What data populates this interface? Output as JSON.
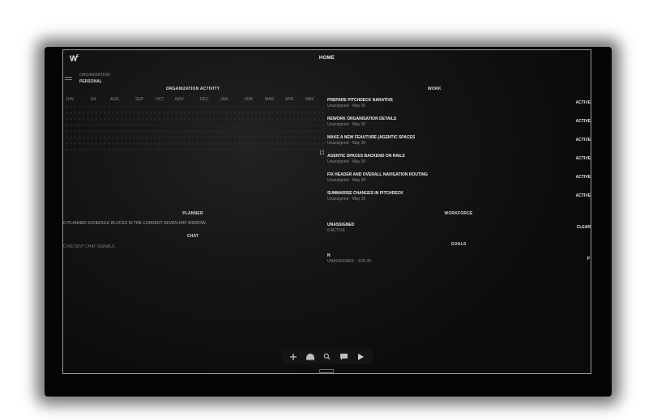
{
  "header": {
    "logo": "W",
    "title": "HOME"
  },
  "org_switcher": {
    "label": "ORGANIZATION",
    "value": "PERSONAL"
  },
  "activity": {
    "title": "ORGANIZATION ACTIVITY",
    "months": [
      "JUN",
      "JUL",
      "AUG",
      "SEP",
      "OCT",
      "NOV",
      "DEC",
      "JAN",
      "FEB",
      "MAR",
      "APR",
      "MAY"
    ]
  },
  "work": {
    "title": "WORK",
    "items": [
      {
        "title": "PREPARE PITCHDECK NARATIVE",
        "meta": "Unassigned · May 30",
        "status": "ACTIVE"
      },
      {
        "title": "REWORK ORGANISATION DETAILS",
        "meta": "Unassigned · May 30",
        "status": "ACTIVE"
      },
      {
        "title": "MAKE A NEW FEAUTURE (AGENTIC SPACES",
        "meta": "Unassigned · May 30",
        "status": "ACTIVE"
      },
      {
        "title": "AGENTIC SPACES BACKEND ON RAILS",
        "meta": "Unassigned · May 30",
        "status": "ACTIVE"
      },
      {
        "title": "FIX HEADER AND OVERALL NAVIGATION ROUTING",
        "meta": "Unassigned · May 30",
        "status": "ACTIVE"
      },
      {
        "title": "SUMMARISE CHANGES IN PITCHDECK",
        "meta": "Unassigned · May 30",
        "status": "ACTIVE"
      }
    ]
  },
  "planner": {
    "title": "PLANNER",
    "empty": "O PLANNER SCHEDULE BLOCKS IN THE CURRENT SEVEN-DAY WINDOW."
  },
  "chat": {
    "title": "CHAT",
    "empty": "O RECENT CHAT SIGNALS."
  },
  "workforce": {
    "title": "WORKFORCE",
    "name": "UNASSIGNED",
    "meta": "6 ACTIVE",
    "action": "CLEAR"
  },
  "goals": {
    "title": "GOALS",
    "name": "N",
    "meta": "UNASSIGNED · JUN 30",
    "status": "P"
  },
  "dock": {
    "icons": [
      "plus-icon",
      "helmet-icon",
      "search-icon",
      "chat-icon",
      "play-icon"
    ]
  }
}
